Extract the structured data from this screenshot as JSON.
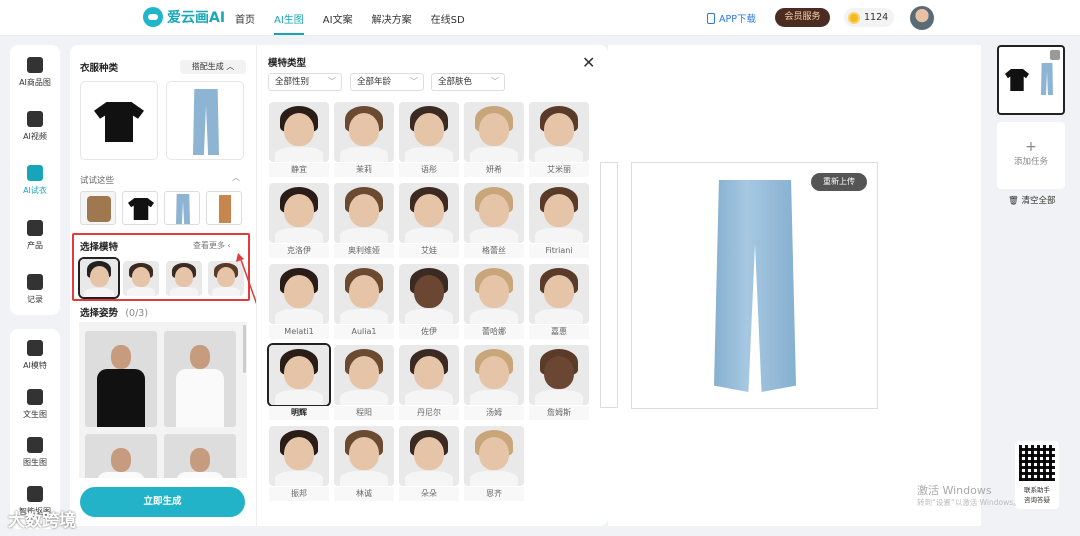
{
  "topbar": {
    "logo_text": "爱云画AI",
    "nav": [
      "首页",
      "AI生图",
      "AI文案",
      "解决方案",
      "在线SD"
    ],
    "active_nav": "AI生图",
    "app_download": "APP下载",
    "vip_button": "会员服务",
    "coins": "1124"
  },
  "leftbar": {
    "items": [
      "AI商品图",
      "AI视频",
      "AI试衣",
      "产品",
      "记录"
    ],
    "active": "AI试衣",
    "items2": [
      "AI模特",
      "文生图",
      "图生图",
      "智能抠图"
    ]
  },
  "panel": {
    "clothes_title": "衣服种类",
    "pair_button": "搭配生成",
    "try_these": "试试这些",
    "select_model": "选择模特",
    "see_more": "查看更多",
    "select_pose": "选择姿势",
    "pose_count": "(0/3)",
    "generate_button": "立即生成"
  },
  "modal": {
    "title": "模特类型",
    "filters": [
      "全部性别",
      "全部年龄",
      "全部肤色"
    ],
    "models": [
      "静宜",
      "茉莉",
      "语彤",
      "妍希",
      "艾米丽",
      "克洛伊",
      "奥利维娅",
      "艾娃",
      "格蕾丝",
      "Fitriani",
      "Melati1",
      "Aulia1",
      "佐伊",
      "蕾哈娜",
      "嘉惠",
      "明辉",
      "程阳",
      "丹尼尔",
      "汤姆",
      "詹姆斯",
      "振邦",
      "林诚",
      "朵朵",
      "恩齐"
    ],
    "selected_model": "明辉"
  },
  "main": {
    "reupload_button": "重新上传"
  },
  "rightcol": {
    "add_task": "添加任务",
    "clear_all": "清空全部",
    "qr_caption_1": "联系助手",
    "qr_caption_2": "咨询答疑"
  },
  "overlay": {
    "watermark_title": "激活 Windows",
    "watermark_sub": "转到“设置”以激活 Windows。",
    "brand": "大数跨境"
  },
  "colors": {
    "accent": "#17a6b9",
    "highlight_border": "#e23b3b",
    "vip_bg": "#4b2c22"
  }
}
